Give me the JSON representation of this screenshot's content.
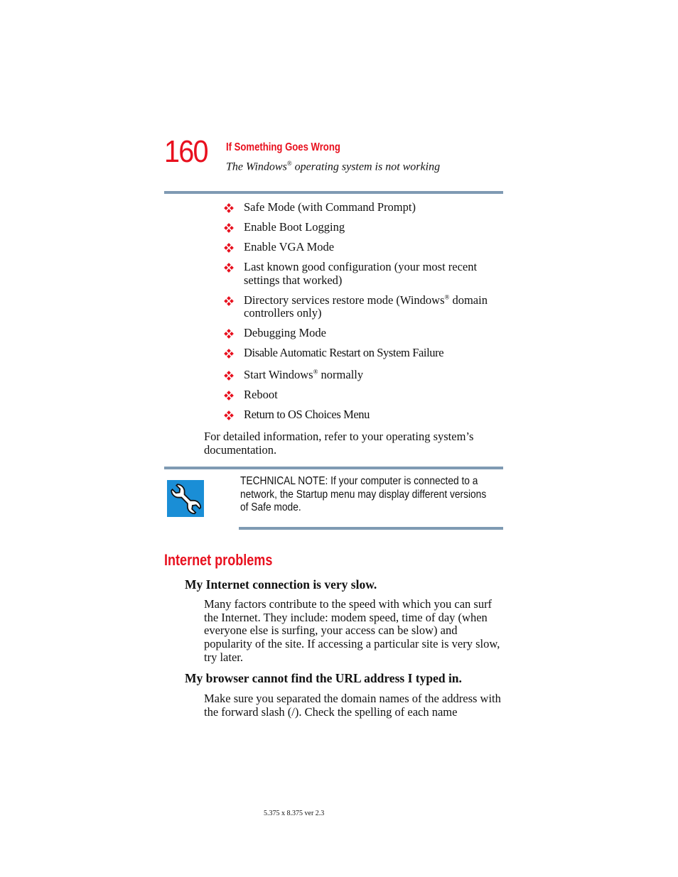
{
  "header": {
    "page_number": "160",
    "chapter_title": "If Something Goes Wrong",
    "section_subtitle_pre": "The Windows",
    "section_subtitle_reg": "®",
    "section_subtitle_post": " operating system is not working"
  },
  "bullet_icon": "red-diamond-bullet-icon",
  "colors": {
    "accent_red": "#e8101e",
    "rule_blue_gray": "#7f9ab3",
    "note_icon_blue": "#1a8ed6"
  },
  "startup_options": [
    {
      "text": "Safe Mode (with Command Prompt)"
    },
    {
      "text": "Enable Boot Logging"
    },
    {
      "text": "Enable VGA Mode"
    },
    {
      "text": "Last known good configuration (your most recent settings that worked)"
    },
    {
      "pre": "Directory services restore mode (Windows",
      "reg": "®",
      "post": " domain controllers only)"
    },
    {
      "text": "Debugging Mode"
    },
    {
      "text": "Disable Automatic Restart on System Failure"
    },
    {
      "pre": "Start Windows",
      "reg": "®",
      "post": " normally"
    },
    {
      "text": "Reboot"
    },
    {
      "text": "Return to OS Choices Menu"
    }
  ],
  "detailed_info": "For detailed information, refer to your operating system’s documentation.",
  "technical_note": {
    "icon": "wrench-icon",
    "text": "TECHNICAL NOTE: If your computer is connected to a network, the Startup menu may display different versions of Safe mode."
  },
  "internet_problems": {
    "heading": "Internet problems",
    "topics": [
      {
        "question": "My Internet connection is very slow.",
        "answer": "Many factors contribute to the speed with which you can surf the Internet. They include: modem speed, time of day (when everyone else is surfing, your access can be slow) and popularity of the site. If accessing a particular site is very slow, try later."
      },
      {
        "question": "My browser cannot find the URL address I typed in.",
        "answer": "Make sure you separated the domain names of the address with the forward slash (/). Check the spelling of each name"
      }
    ]
  },
  "footer": {
    "page_spec": "5.375 x 8.375 ver 2.3"
  }
}
